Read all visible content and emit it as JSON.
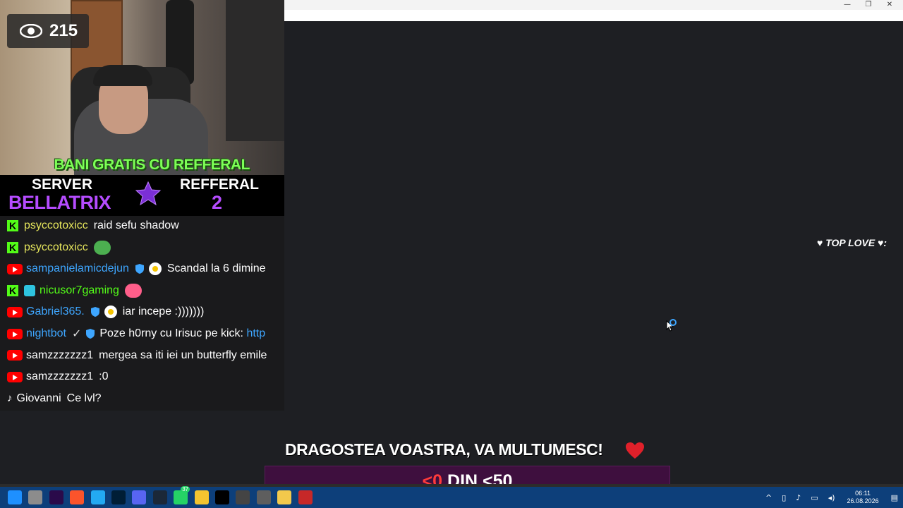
{
  "viewer": {
    "count": "215",
    "icon": "eye-icon"
  },
  "webcam": {
    "banner": "BANI GRATIS CU REFFERAL",
    "banner_emoji": "money-icon"
  },
  "server": {
    "label": "SERVER",
    "name": "BELLATRIX",
    "refferal_label": "REFFERAL",
    "refferal_count": "2"
  },
  "chat": [
    {
      "platform": "kick",
      "user": "psyccotoxicc",
      "user_color": "#e6e65c",
      "text": "raid sefu shadow",
      "badges": []
    },
    {
      "platform": "kick",
      "user": "psyccotoxicc",
      "user_color": "#e6e65c",
      "text": "",
      "emote": "pepe-emote-icon",
      "badges": []
    },
    {
      "platform": "youtube",
      "user": "sampanielamicdejun",
      "user_color": "#3ea6ff",
      "text": "Scandal la 6 dimine",
      "badges": [
        "shield",
        "egg"
      ]
    },
    {
      "platform": "kick",
      "user": "nicusor7gaming",
      "user_color": "#53fc18",
      "text": "",
      "emote": "popsicle-emote-icon",
      "badges": [
        "square"
      ]
    },
    {
      "platform": "youtube",
      "user": "Gabriel365.",
      "user_color": "#3ea6ff",
      "text": "iar incepe :)))))))",
      "badges": [
        "shield",
        "egg"
      ]
    },
    {
      "platform": "youtube",
      "user": "nightbot",
      "user_color": "#3ea6ff",
      "text": "Poze h0rny cu Irisuc pe kick: ",
      "link": "http",
      "badges": [
        "check",
        "shield"
      ]
    },
    {
      "platform": "youtube",
      "user": "samzzzzzzz1",
      "user_color": "#ffffff",
      "text": "mergea sa iti iei un butterfly emile",
      "badges": []
    },
    {
      "platform": "youtube",
      "user": "samzzzzzzz1",
      "user_color": "#ffffff",
      "text": ":0",
      "badges": []
    },
    {
      "platform": "tiktok",
      "user": "Giovanni",
      "user_color": "#ffffff",
      "text": "Ce lvl?",
      "badges": []
    }
  ],
  "top_love": {
    "label": "TOP LOVE",
    "icon": "heart-icon"
  },
  "goal": {
    "thanks": "DRAGOSTEA VOASTRA, VA MULTUMESC!",
    "current": "<0",
    "separator": " DIN ",
    "target": "<50",
    "progress": 0.0
  },
  "window_controls": {
    "minimize": "—",
    "maximize": "❐",
    "close": "✕"
  },
  "taskbar": {
    "icons": [
      "start-icon",
      "task-view-icon",
      "premiere-icon",
      "brave-icon",
      "vscode-icon",
      "photoshop-icon",
      "discord-icon",
      "steam-icon",
      "whatsapp-icon",
      "file-explorer-icon",
      "tiktok-icon",
      "chrome-icon",
      "calculator-icon",
      "notes-icon",
      "app-icon"
    ],
    "whatsapp_badge": "37",
    "time": "06:11",
    "date": "26.08.2026"
  }
}
